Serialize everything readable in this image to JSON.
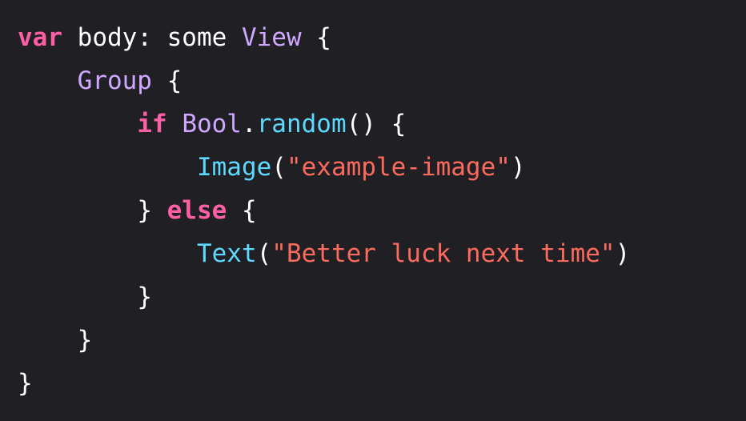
{
  "colors": {
    "background": "#1f1f24",
    "keyword": "#fc5fa3",
    "type": "#d0a8ff",
    "function": "#5dd8ff",
    "string": "#fc6a5d",
    "plain": "#ffffff"
  },
  "code": {
    "line1": {
      "kw": "var",
      "plain1": " body: some ",
      "type": "View",
      "plain2": " {"
    },
    "line2": {
      "indent": "    ",
      "type": "Group",
      "plain": " {"
    },
    "line3": {
      "indent": "        ",
      "kw": "if",
      "sp": " ",
      "type": "Bool",
      "dot": ".",
      "fn": "random",
      "plain": "() {"
    },
    "line4": {
      "indent": "            ",
      "fn": "Image",
      "open": "(",
      "str": "\"example-image\"",
      "close": ")"
    },
    "line5": {
      "indent": "        ",
      "plain1": "} ",
      "kw": "else",
      "plain2": " {"
    },
    "line6": {
      "indent": "            ",
      "fn": "Text",
      "open": "(",
      "str": "\"Better luck next time\"",
      "close": ")"
    },
    "line7": {
      "indent": "        ",
      "plain": "}"
    },
    "line8": {
      "indent": "    ",
      "plain": "}"
    },
    "line9": {
      "plain": "}"
    }
  }
}
